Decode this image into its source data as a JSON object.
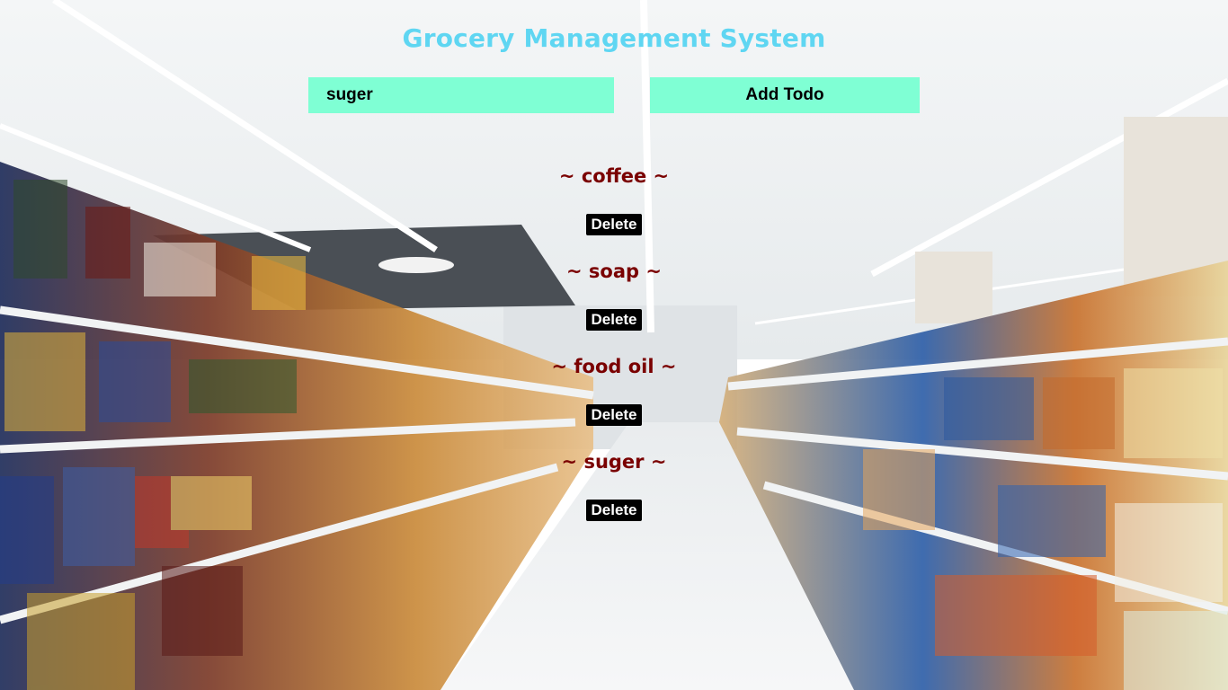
{
  "app": {
    "title": "Grocery Management System"
  },
  "form": {
    "input_value": "suger",
    "add_label": "Add Todo"
  },
  "todos": [
    {
      "text": "~ coffee ~",
      "delete_label": "Delete"
    },
    {
      "text": "~ soap ~",
      "delete_label": "Delete"
    },
    {
      "text": "~ food oil ~",
      "delete_label": "Delete"
    },
    {
      "text": "~ suger ~",
      "delete_label": "Delete"
    }
  ],
  "colors": {
    "title": "#5fd6f2",
    "accent": "#7fffd4",
    "item_text": "#7a0000",
    "delete_bg": "#000000"
  }
}
